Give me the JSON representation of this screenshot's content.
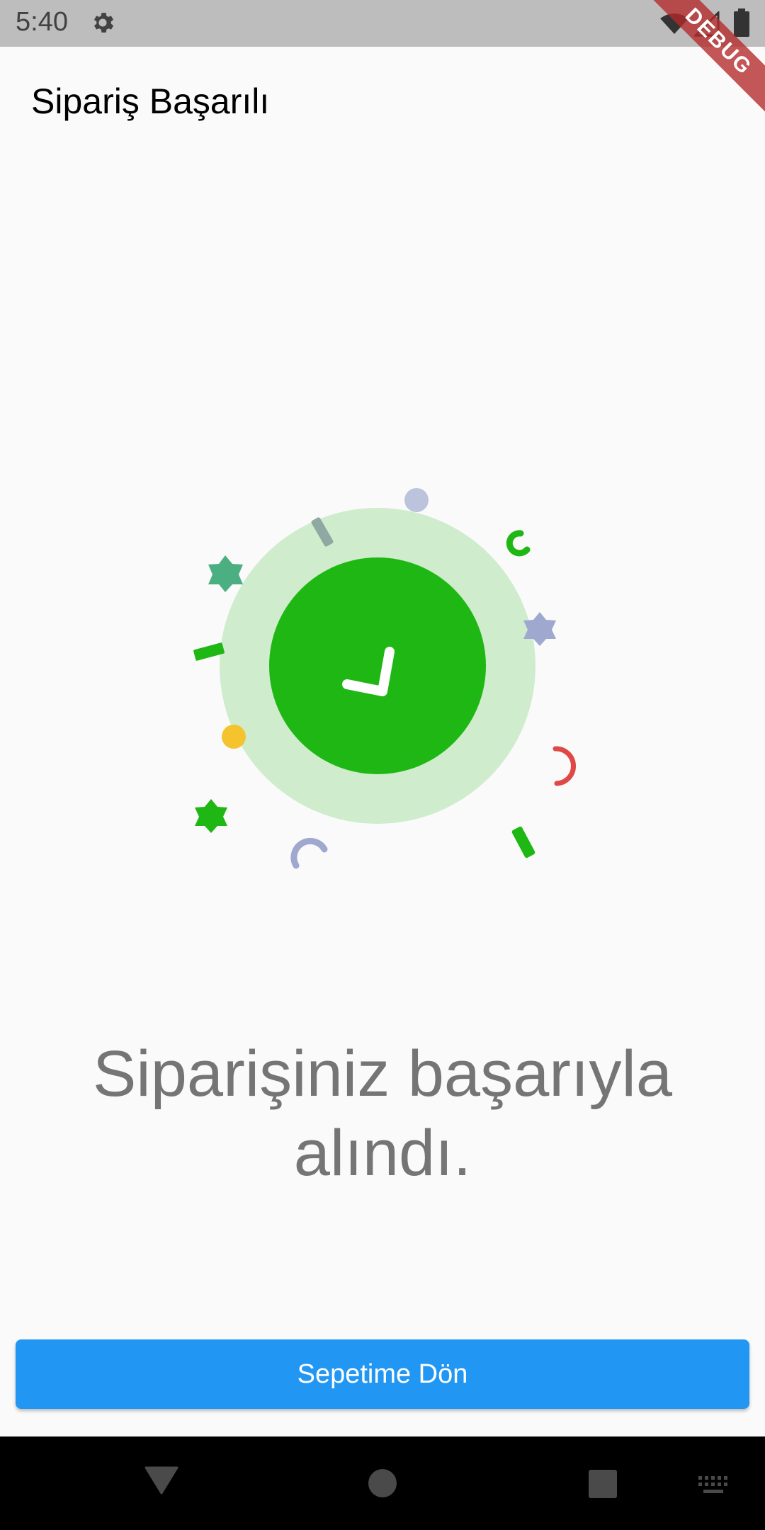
{
  "status_bar": {
    "time": "5:40",
    "icons": [
      "settings-gear-icon",
      "wifi-icon",
      "cell-signal-icon",
      "battery-icon"
    ]
  },
  "debug_banner": "DEBUG",
  "app_bar": {
    "title": "Sipariş Başarılı"
  },
  "illustration": {
    "icon": "checkmark-icon",
    "colors": {
      "outer_circle": "#cfeccd",
      "inner_circle": "#1fb714",
      "check": "#ffffff"
    }
  },
  "message": {
    "line1": "Siparişiniz başarıyla",
    "line2": "alındı."
  },
  "primary_button": {
    "label": "Sepetime Dön",
    "color": "#2196f3"
  },
  "nav_bar": {
    "icons": [
      "back-icon",
      "home-icon",
      "recents-icon",
      "keyboard-icon"
    ]
  }
}
